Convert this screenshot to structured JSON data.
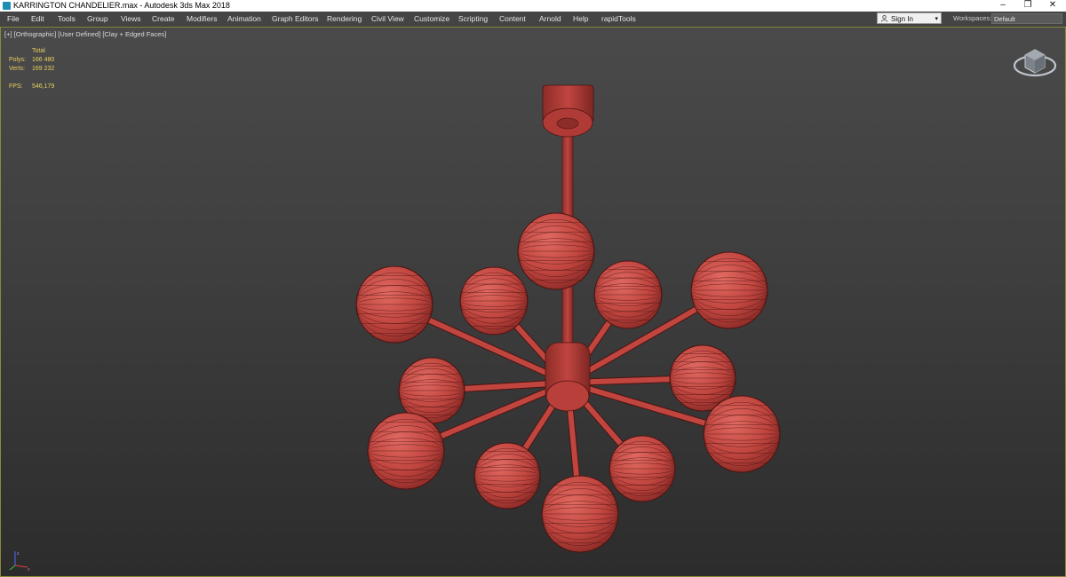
{
  "window": {
    "title": "KARRINGTON CHANDELIER.max - Autodesk 3ds Max 2018",
    "minimize": "–",
    "restore": "❐",
    "close": "✕"
  },
  "menu": [
    "File",
    "Edit",
    "Tools",
    "Group",
    "Views",
    "Create",
    "Modifiers",
    "Animation",
    "Graph Editors",
    "Rendering",
    "Civil View",
    "Customize",
    "Scripting",
    "Content",
    "Arnold",
    "Help",
    "rapidTools"
  ],
  "account": {
    "signin_label": "Sign In",
    "caret": "▾"
  },
  "workspaces": {
    "label": "Workspaces:",
    "value": "Default"
  },
  "viewport": {
    "labels": [
      "[+]",
      "[Orthographic]",
      "[User Defined]",
      "[Clay + Edged Faces]"
    ],
    "stats": {
      "total_label": "Total",
      "polys_label": "Polys:",
      "polys_value": "166 480",
      "verts_label": "Verts:",
      "verts_value": "169 232",
      "fps_label": "FPS:",
      "fps_value": "546,179"
    },
    "model_color": "#c0453f",
    "wire_color": "#4a1412"
  },
  "icons": {
    "app": "3dsmax-app-icon",
    "user": "user-icon",
    "viewcube": "viewcube-icon",
    "axis": "axis-tripod-icon"
  }
}
